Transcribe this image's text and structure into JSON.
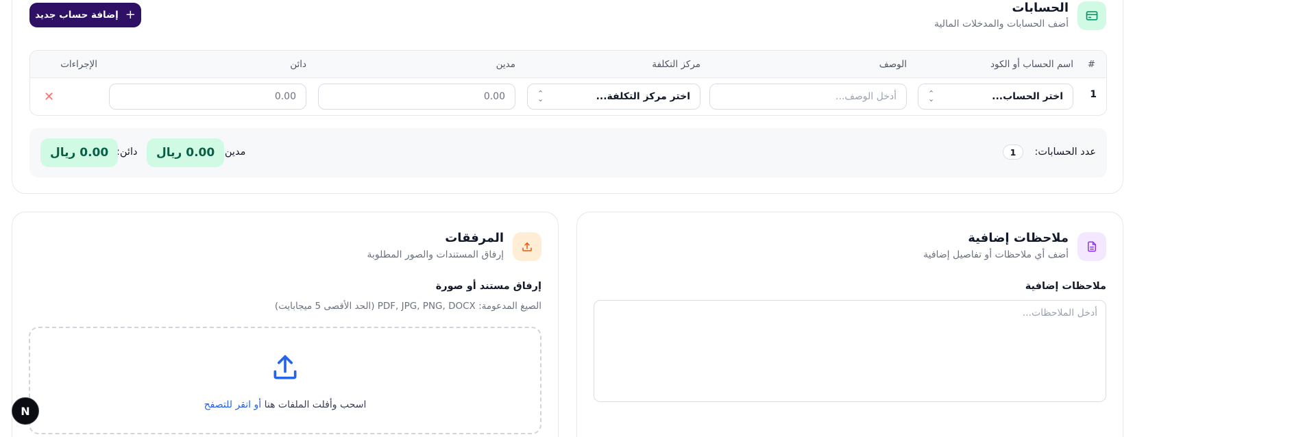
{
  "accounts": {
    "title": "الحسابات",
    "subtitle": "أضف الحسابات والمدخلات المالية",
    "add_button_label": "إضافة حساب جديد",
    "add_button_icon": "plus-icon",
    "header_icon": "credit-card-icon",
    "table": {
      "headers": {
        "num": "#",
        "account": "اسم الحساب أو الكود",
        "description": "الوصف",
        "cost_center": "مركز التكلفة",
        "debit": "مدين",
        "credit": "دائن",
        "actions": "الإجراءات"
      },
      "rows": [
        {
          "num": "1",
          "account_select": "اختر الحساب...",
          "description_placeholder": "أدخل الوصف...",
          "cost_center_select": "اختر مركز التكلفة...",
          "debit": "0.00",
          "credit": "0.00",
          "delete_icon": "close-icon"
        }
      ]
    },
    "summary": {
      "count_label": "عدد الحسابات:",
      "count_value": "1",
      "debit_label": "مدين:",
      "debit_value": "0.00 ريال",
      "credit_label": "دائن:",
      "credit_value": "0.00 ريال"
    }
  },
  "notes": {
    "title": "ملاحظات إضافية",
    "subtitle": "أضف أي ملاحظات أو تفاصيل إضافية",
    "header_icon": "document-icon",
    "field_label": "ملاحظات إضافية",
    "placeholder": "أدخل الملاحظات..."
  },
  "attachments": {
    "title": "المرفقات",
    "subtitle": "إرفاق المستندات والصور المطلوبة",
    "header_icon": "upload-icon",
    "field_label": "إرفاق مستند أو صورة",
    "formats_hint": "الصيغ المدعومة: PDF, JPG, PNG, DOCX (الحد الأقصى 5 ميجابايت)",
    "drop_text": "اسحب وأفلت الملفات هنا",
    "browse_link": "أو انقر للتصفح",
    "drop_icon": "upload-arrow-icon"
  },
  "floating_badge": {
    "label": "N"
  },
  "colors": {
    "primary": "#2e1065",
    "success_bg": "#d1fae5",
    "success_text": "#065f46",
    "danger": "#f87171",
    "link": "#2563eb"
  }
}
